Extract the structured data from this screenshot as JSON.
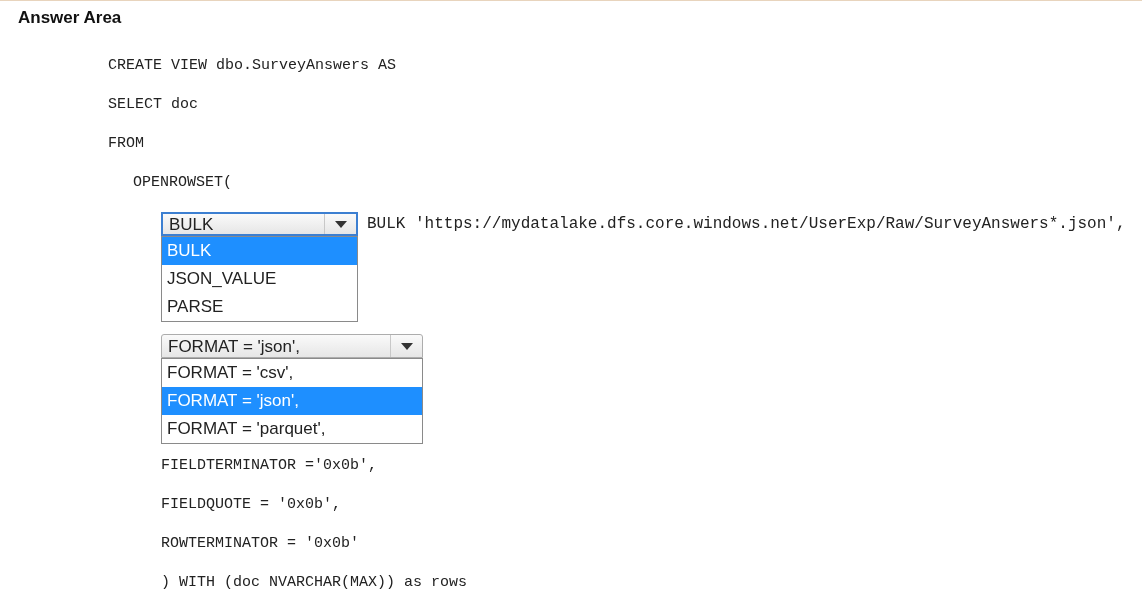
{
  "title": "Answer Area",
  "code": [
    {
      "kind": "line",
      "text": "CREATE VIEW dbo.SurveyAnswers AS"
    },
    {
      "kind": "line",
      "text": "SELECT doc"
    },
    {
      "kind": "line",
      "text": "FROM",
      "children": [
        {
          "kind": "line",
          "text": "OPENROWSET(",
          "children": [
            {
              "kind": "dropdown",
              "focused": true,
              "expanded": true,
              "value": "BULK",
              "trailing_text": "BULK 'https://mydatalake.dfs.core.windows.net/UserExp/Raw/SurveyAnswers*.json',",
              "options": [
                {
                  "label": "BULK",
                  "selected": true
                },
                {
                  "label": "JSON_VALUE",
                  "selected": false
                },
                {
                  "label": "PARSE",
                  "selected": false
                }
              ]
            },
            {
              "kind": "dropdown",
              "focused": false,
              "expanded": true,
              "value": "FORMAT = 'json',",
              "options": [
                {
                  "label": "FORMAT = 'csv',",
                  "selected": false
                },
                {
                  "label": "FORMAT = 'json',",
                  "selected": true
                },
                {
                  "label": "FORMAT = 'parquet',",
                  "selected": false
                }
              ]
            },
            {
              "kind": "line",
              "text": "FIELDTERMINATOR ='0x0b',"
            },
            {
              "kind": "line",
              "text": "FIELDQUOTE = '0x0b',"
            },
            {
              "kind": "line",
              "text": "ROWTERMINATOR = '0x0b'"
            },
            {
              "kind": "line",
              "text": ") WITH (doc NVARCHAR(MAX)) as rows"
            }
          ]
        }
      ]
    }
  ]
}
